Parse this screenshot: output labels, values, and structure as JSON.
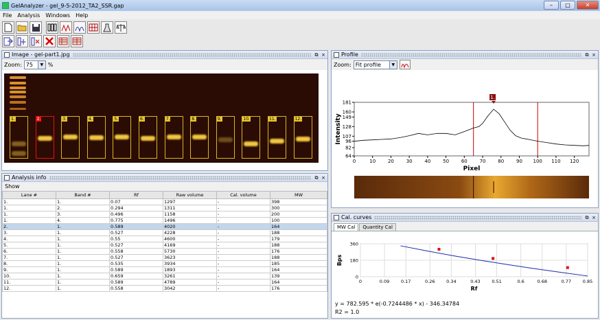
{
  "window": {
    "title": "GelAnalyzer - gel_9-5-2012_TA2_SSR.gap"
  },
  "menu": [
    "File",
    "Analysis",
    "Windows",
    "Help"
  ],
  "image_panel": {
    "title": "Image - gel-part1.jpg",
    "zoom_label": "Zoom:",
    "zoom_value": "75",
    "zoom_unit": "%"
  },
  "lanes": [
    "1.",
    "2.",
    "3.",
    "4.",
    "5.",
    "6.",
    "7.",
    "8.",
    "9.",
    "10.",
    "11.",
    "12."
  ],
  "profile_panel": {
    "title": "Profile",
    "zoom_label": "Zoom:",
    "zoom_value": "Fit profile",
    "peak_label": "1.",
    "xlabel": "Pixel",
    "ylabel": "Intensity",
    "yticks": [
      "181",
      "160",
      "149",
      "128",
      "107",
      "96",
      "82",
      "64"
    ],
    "xticks": [
      "0",
      "10",
      "20",
      "30",
      "40",
      "50",
      "60",
      "70",
      "80",
      "90",
      "100",
      "110",
      "120"
    ]
  },
  "analysis_panel": {
    "title": "Analysis info",
    "show_label": "Show",
    "columns": [
      "Lane #",
      "Band #",
      "Rf",
      "Raw volume",
      "Cal. volume",
      "MW"
    ],
    "rows": [
      [
        "1.",
        "1.",
        "0.07",
        "1297",
        "-",
        "398"
      ],
      [
        "1.",
        "2.",
        "0.294",
        "1311",
        "-",
        "300"
      ],
      [
        "1.",
        "3.",
        "0.496",
        "1158",
        "-",
        "200"
      ],
      [
        "1.",
        "4.",
        "0.775",
        "1496",
        "-",
        "100"
      ],
      [
        "2.",
        "1.",
        "0.589",
        "4020",
        "-",
        "164"
      ],
      [
        "3.",
        "1.",
        "0.527",
        "4228",
        "-",
        "188"
      ],
      [
        "4.",
        "1.",
        "0.55",
        "4600",
        "-",
        "179"
      ],
      [
        "5.",
        "1.",
        "0.527",
        "4169",
        "-",
        "188"
      ],
      [
        "6.",
        "1.",
        "0.558",
        "5730",
        "-",
        "176"
      ],
      [
        "7.",
        "1.",
        "0.527",
        "3623",
        "-",
        "188"
      ],
      [
        "8.",
        "1.",
        "0.535",
        "3934",
        "-",
        "185"
      ],
      [
        "9.",
        "1.",
        "0.589",
        "1893",
        "-",
        "164"
      ],
      [
        "10.",
        "1.",
        "0.659",
        "3261",
        "-",
        "139"
      ],
      [
        "11.",
        "1.",
        "0.589",
        "4789",
        "-",
        "164"
      ],
      [
        "12.",
        "1.",
        "0.558",
        "3042",
        "-",
        "176"
      ]
    ]
  },
  "cal_panel": {
    "title": "Cal. curves",
    "tabs": [
      "MW Cal",
      "Quantity Cal"
    ],
    "ylabel": "Bps",
    "xlabel": "Rf",
    "yticks": [
      "360",
      "180",
      "0"
    ],
    "xticks": [
      "0",
      "0.09",
      "0.17",
      "0.26",
      "0.34",
      "0.43",
      "0.51",
      "0.6",
      "0.68",
      "0.77",
      "0.85"
    ],
    "formula": "y = 782.595 * e(-0.7244486 * x) - 346.34784",
    "r2": "R2 = 1.0"
  },
  "chart_data": [
    {
      "type": "line",
      "title": "",
      "xlabel": "Pixel",
      "ylabel": "Intensity",
      "xlim": [
        0,
        128
      ],
      "ylim": [
        64,
        181
      ],
      "series": [
        {
          "x": [
            0,
            5,
            10,
            15,
            20,
            25,
            30,
            35,
            40,
            45,
            50,
            55,
            60,
            65,
            68,
            70,
            73,
            76,
            79,
            82,
            85,
            88,
            91,
            95,
            100,
            105,
            110,
            115,
            120,
            125,
            128
          ],
          "values": [
            96,
            98,
            99,
            100,
            101,
            104,
            108,
            113,
            110,
            113,
            113,
            110,
            117,
            125,
            128,
            135,
            152,
            166,
            156,
            138,
            120,
            108,
            103,
            100,
            96,
            93,
            90,
            88,
            87,
            86,
            87
          ]
        }
      ],
      "markers": [
        {
          "x": 65
        },
        {
          "x": 100
        }
      ],
      "peak": {
        "label": "1.",
        "x": 76
      }
    },
    {
      "type": "line",
      "title": "",
      "xlabel": "Rf",
      "ylabel": "Bps",
      "xlim": [
        0,
        0.85
      ],
      "ylim": [
        0,
        360
      ],
      "series": [
        {
          "x": [
            0.07,
            0.15,
            0.25,
            0.35,
            0.45,
            0.55,
            0.65,
            0.75,
            0.85
          ],
          "values": [
            393,
            338,
            281,
            228,
            179,
            133,
            89,
            48,
            8
          ]
        }
      ],
      "points": {
        "x": [
          0.294,
          0.496,
          0.775
        ],
        "values": [
          300,
          200,
          100
        ]
      }
    }
  ]
}
